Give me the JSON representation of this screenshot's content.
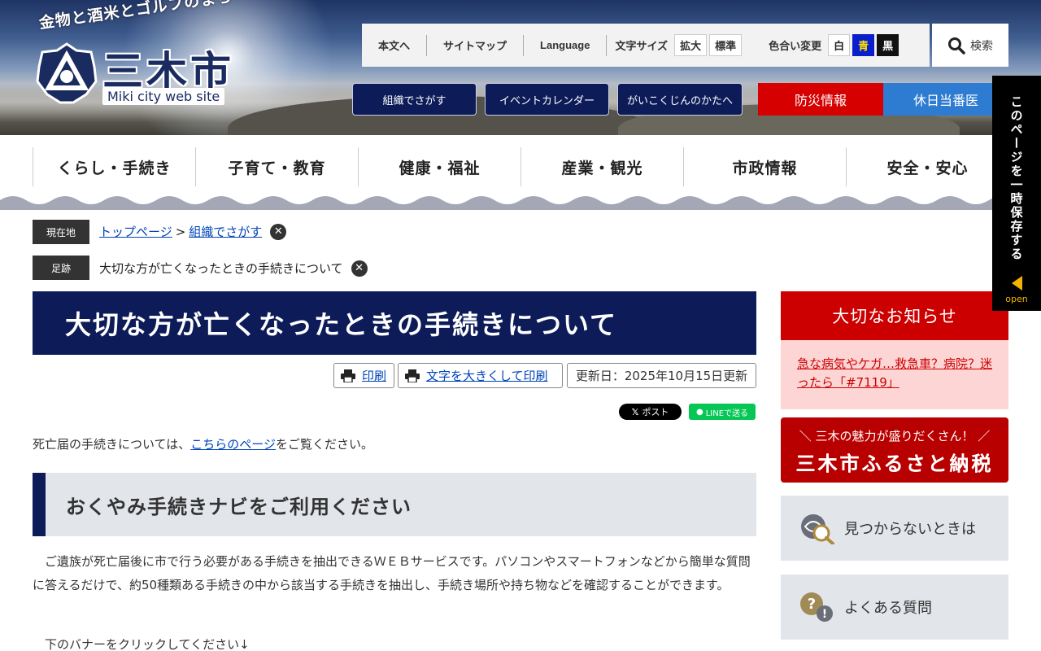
{
  "header": {
    "catchphrase": "金物と酒米とゴルフのまち",
    "city_name": "三木市",
    "site_subtitle": "Miki city web site"
  },
  "utility": {
    "skip_link": "本文へ",
    "sitemap": "サイトマップ",
    "language": "Language",
    "font_size_label": "文字サイズ",
    "font_enlarge": "拡大",
    "font_standard": "標準",
    "color_label": "色合い変更",
    "color_white": "白",
    "color_blue": "青",
    "color_black": "黒",
    "search": "検索"
  },
  "subnav": {
    "org_search": "組織でさがす",
    "event_calendar": "イベントカレンダー",
    "foreign": "がいこくじんのかたへ",
    "disaster": "防災情報",
    "holiday_doctor": "休日当番医"
  },
  "global_nav": [
    "くらし・手続き",
    "子育て・教育",
    "健康・福祉",
    "産業・観光",
    "市政情報",
    "安全・安心"
  ],
  "breadcrumb": {
    "current_tag": "現在地",
    "home": "トップページ",
    "separator": ">",
    "org": "組織でさがす",
    "history_tag": "足跡",
    "history_item": "大切な方が亡くなったときの手続きについて"
  },
  "main": {
    "title": "大切な方が亡くなったときの手続きについて",
    "print": "印刷",
    "print_large": "文字を大きくして印刷",
    "updated": "更新日：2025年10月15日更新",
    "x_post": "ポスト",
    "line_share": "LINEで送る",
    "intro_before": "死亡届の手続きについては、",
    "intro_link": "こちらのページ",
    "intro_after": "をご覧ください。",
    "section_heading": "おくやみ手続きナビをご利用ください",
    "body": "ご遺族が死亡届後に市で行う必要がある手続きを抽出できるＷＥＢサービスです。パソコンやスマートフォンなどから簡単な質問に答えるだけで、約50種類ある手続きの中から該当する手続きを抽出し、手続き場所や持ち物などを確認することができます。",
    "body2": "下のバナーをクリックしてください↓"
  },
  "sidebar": {
    "notice_heading": "大切なお知らせ",
    "notice_link": "急な病気やケガ…救急車？病院？迷ったら「#7119」",
    "furusato_catch": "＼ 三木の魅力が盛りだくさん！ ／",
    "furusato_title": "三木市ふるさと納税",
    "not_found": "見つからないときは",
    "faq": "よくある質問"
  },
  "float_tab": {
    "label": "このページを一時保存する",
    "open": "open"
  },
  "colors": {
    "navy": "#0d1c58",
    "red": "#cc0000",
    "blue": "#2e7bd2",
    "pink": "#fdd5d5",
    "gray": "#e2e5ea"
  }
}
